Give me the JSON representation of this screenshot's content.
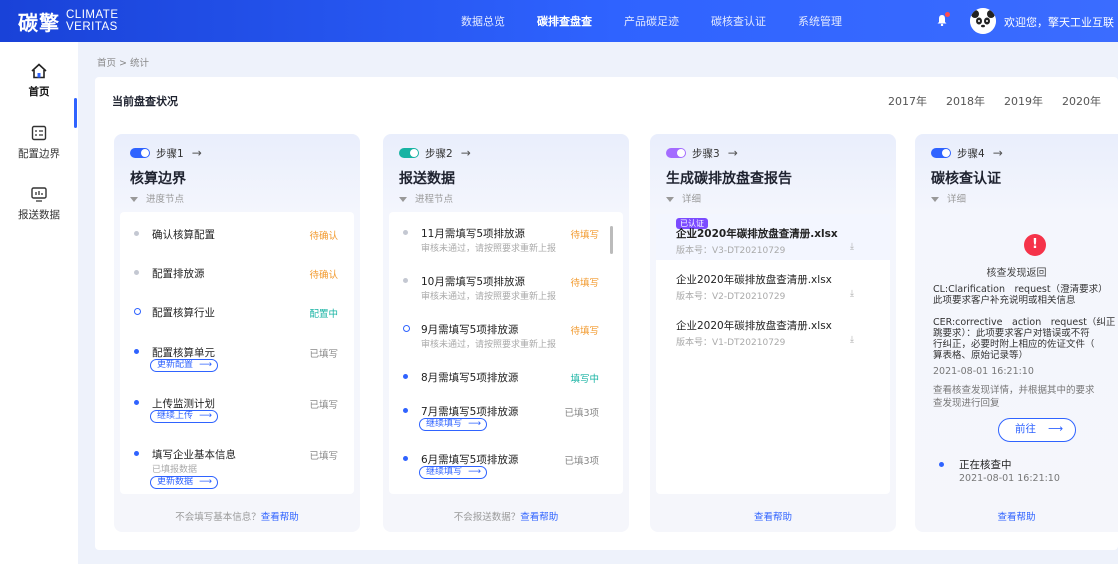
{
  "header": {
    "logo_cn": "碳擎",
    "logo_en_line1": "CLIMATE",
    "logo_en_line2": "VERITAS",
    "nav": [
      "数据总览",
      "碳排查盘查",
      "产品碳足迹",
      "碳核查认证",
      "系统管理"
    ],
    "active_nav": "碳排查盘查",
    "greeting": "欢迎您，擎天工业互联",
    "accent": "#2f63ff"
  },
  "sidebar": {
    "items": [
      {
        "label": "首页",
        "icon": "home-icon",
        "active": true
      },
      {
        "label": "配置边界",
        "icon": "config-icon",
        "active": false
      },
      {
        "label": "报送数据",
        "icon": "report-icon",
        "active": false
      }
    ]
  },
  "breadcrumb": "首页 > 统计",
  "section_title": "当前盘查状况",
  "years": [
    "2017年",
    "2018年",
    "2019年",
    "2020年"
  ],
  "columns": [
    {
      "step": "步骤1",
      "toggle_color": "#2f63ff",
      "title": "核算边界",
      "sub": "进度节点",
      "rows": [
        {
          "text": "确认核算配置",
          "status": "待确认",
          "status_type": "orange",
          "dot": "g"
        },
        {
          "text": "配置排放源",
          "status": "待确认",
          "status_type": "orange",
          "dot": "g"
        },
        {
          "text": "配置核算行业",
          "status": "配置中",
          "status_type": "teal",
          "dot": "o"
        },
        {
          "text": "配置核算单元",
          "status": "已填写",
          "status_type": "grey",
          "dot": "b",
          "btn": "更新配置"
        },
        {
          "text": "上传监测计划",
          "status": "已填写",
          "status_type": "grey",
          "dot": "b",
          "btn": "继续上传"
        },
        {
          "text": "填写企业基本信息",
          "sub": "已填报数据",
          "status": "已填写",
          "status_type": "grey",
          "dot": "b",
          "btn": "更新数据"
        }
      ],
      "foot_text": "不会填写基本信息？",
      "foot_link": "查看帮助"
    },
    {
      "step": "步骤2",
      "toggle_color": "#17b3a3",
      "title": "报送数据",
      "sub": "进程节点",
      "rows": [
        {
          "text": "11月需填写5项排放源",
          "sub": "审核未通过，请按照要求重新上报",
          "status": "待填写",
          "status_type": "orange",
          "dot": "g"
        },
        {
          "text": "10月需填写5项排放源",
          "sub": "审核未通过，请按照要求重新上报",
          "status": "待填写",
          "status_type": "orange",
          "dot": "g"
        },
        {
          "text": "9月需填写5项排放源",
          "sub": "审核未通过，请按照要求重新上报",
          "status": "待填写",
          "status_type": "orange",
          "dot": "o"
        },
        {
          "text": "8月需填写5项排放源",
          "status": "填写中",
          "status_type": "teal",
          "dot": "b"
        },
        {
          "text": "7月需填写5项排放源",
          "status": "已填3项",
          "status_type": "grey",
          "dot": "b",
          "btn": "继续填写"
        },
        {
          "text": "6月需填写5项排放源",
          "status": "已填3项",
          "status_type": "grey",
          "dot": "b",
          "btn": "继续填写"
        }
      ],
      "foot_text": "不会报送数据？",
      "foot_link": "查看帮助"
    },
    {
      "step": "步骤3",
      "toggle_color": "#a46cff",
      "title": "生成碳排放盘查报告",
      "sub": "详细",
      "files": [
        {
          "tag": "已认证",
          "name": "企业2020年碳排放盘查清册.xlsx",
          "version": "版本号：V3-DT20210729",
          "bold": true
        },
        {
          "name": "企业2020年碳排放盘查清册.xlsx",
          "version": "版本号：V2-DT20210729"
        },
        {
          "name": "企业2020年碳排放盘查清册.xlsx",
          "version": "版本号：V1-DT20210729"
        }
      ],
      "foot_link": "查看帮助"
    },
    {
      "step": "步骤4",
      "toggle_color": "#2f63ff",
      "title": "碳核查认证",
      "sub": "详细",
      "card_title": "核查发现返回",
      "lines": [
        "CL:Clarification　request（澄清要求）",
        "此项要求客户补充说明或相关信息",
        "CER:corrective　action　request（纠正",
        "跳要求）：此项要求客户对错误或不符",
        "行纠正，必要时附上相应的佐证文件（",
        "算表格、原始记录等）"
      ],
      "time1": "2021-08-01 16:21:10",
      "desc": [
        "查看核查发现详情，并根据其中的要求",
        "查发现进行回复"
      ],
      "go_btn": "前往",
      "status": "正在核查中",
      "time2": "2021-08-01 16:21:10",
      "foot_link": "查看帮助"
    }
  ]
}
